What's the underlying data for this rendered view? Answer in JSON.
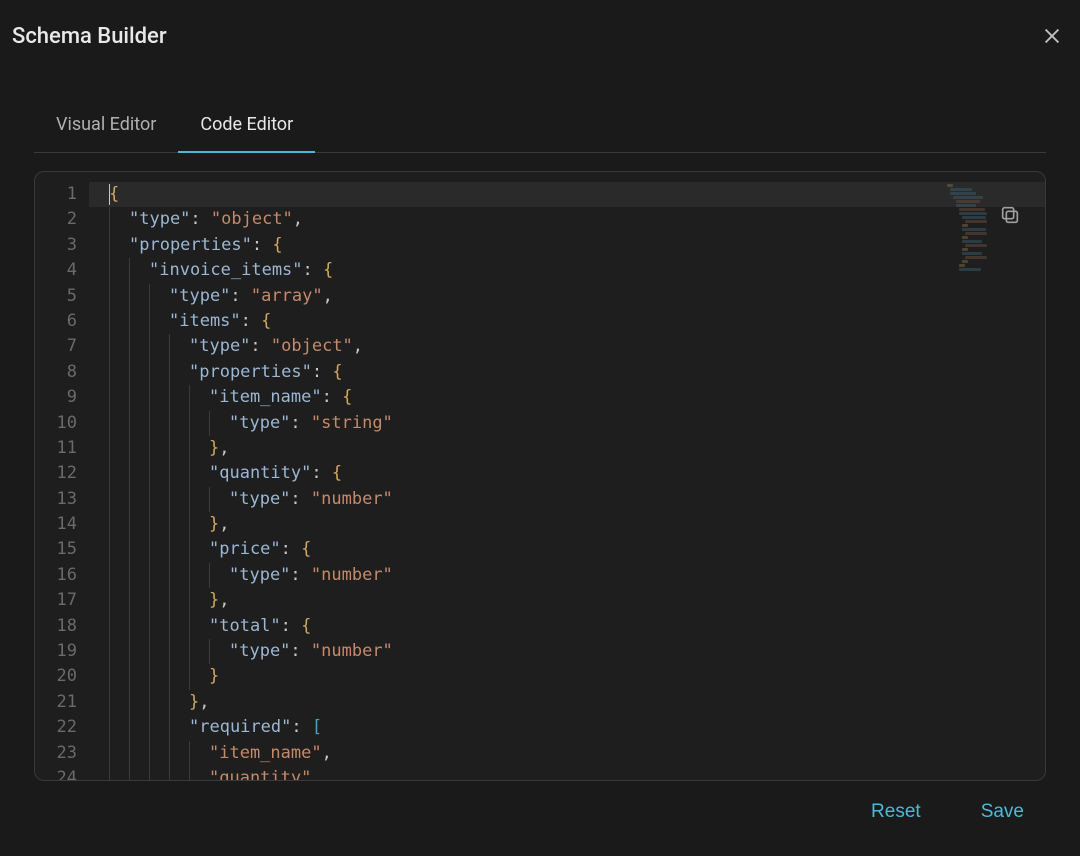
{
  "dialog": {
    "title": "Schema Builder"
  },
  "tabs": {
    "visual": "Visual Editor",
    "code": "Code Editor",
    "active": "code"
  },
  "editor": {
    "line_count": 24,
    "cursor_line": 1,
    "visible_lines": [
      1,
      2,
      3,
      4,
      5,
      6,
      7,
      8,
      9,
      10,
      11,
      12,
      13,
      14,
      15,
      16,
      17,
      18,
      19,
      20,
      21,
      22,
      23,
      24
    ],
    "code_lines": [
      [
        {
          "t": "brace",
          "v": "{"
        }
      ],
      [
        {
          "t": "pad",
          "w": 1
        },
        {
          "t": "key",
          "v": "\"type\""
        },
        {
          "t": "punc",
          "v": ": "
        },
        {
          "t": "string",
          "v": "\"object\""
        },
        {
          "t": "comma",
          "v": ","
        }
      ],
      [
        {
          "t": "pad",
          "w": 1
        },
        {
          "t": "key",
          "v": "\"properties\""
        },
        {
          "t": "punc",
          "v": ": "
        },
        {
          "t": "brace",
          "v": "{"
        }
      ],
      [
        {
          "t": "pad",
          "w": 2
        },
        {
          "t": "key",
          "v": "\"invoice_items\""
        },
        {
          "t": "punc",
          "v": ": "
        },
        {
          "t": "brace",
          "v": "{"
        }
      ],
      [
        {
          "t": "pad",
          "w": 3
        },
        {
          "t": "key",
          "v": "\"type\""
        },
        {
          "t": "punc",
          "v": ": "
        },
        {
          "t": "string",
          "v": "\"array\""
        },
        {
          "t": "comma",
          "v": ","
        }
      ],
      [
        {
          "t": "pad",
          "w": 3
        },
        {
          "t": "key",
          "v": "\"items\""
        },
        {
          "t": "punc",
          "v": ": "
        },
        {
          "t": "brace",
          "v": "{"
        }
      ],
      [
        {
          "t": "pad",
          "w": 4
        },
        {
          "t": "key",
          "v": "\"type\""
        },
        {
          "t": "punc",
          "v": ": "
        },
        {
          "t": "string",
          "v": "\"object\""
        },
        {
          "t": "comma",
          "v": ","
        }
      ],
      [
        {
          "t": "pad",
          "w": 4
        },
        {
          "t": "key",
          "v": "\"properties\""
        },
        {
          "t": "punc",
          "v": ": "
        },
        {
          "t": "brace",
          "v": "{"
        }
      ],
      [
        {
          "t": "pad",
          "w": 5
        },
        {
          "t": "key",
          "v": "\"item_name\""
        },
        {
          "t": "punc",
          "v": ": "
        },
        {
          "t": "brace",
          "v": "{"
        }
      ],
      [
        {
          "t": "pad",
          "w": 6
        },
        {
          "t": "key",
          "v": "\"type\""
        },
        {
          "t": "punc",
          "v": ": "
        },
        {
          "t": "string",
          "v": "\"string\""
        }
      ],
      [
        {
          "t": "pad",
          "w": 5
        },
        {
          "t": "brace",
          "v": "}"
        },
        {
          "t": "comma",
          "v": ","
        }
      ],
      [
        {
          "t": "pad",
          "w": 5
        },
        {
          "t": "key",
          "v": "\"quantity\""
        },
        {
          "t": "punc",
          "v": ": "
        },
        {
          "t": "brace",
          "v": "{"
        }
      ],
      [
        {
          "t": "pad",
          "w": 6
        },
        {
          "t": "key",
          "v": "\"type\""
        },
        {
          "t": "punc",
          "v": ": "
        },
        {
          "t": "string",
          "v": "\"number\""
        }
      ],
      [
        {
          "t": "pad",
          "w": 5
        },
        {
          "t": "brace",
          "v": "}"
        },
        {
          "t": "comma",
          "v": ","
        }
      ],
      [
        {
          "t": "pad",
          "w": 5
        },
        {
          "t": "key",
          "v": "\"price\""
        },
        {
          "t": "punc",
          "v": ": "
        },
        {
          "t": "brace",
          "v": "{"
        }
      ],
      [
        {
          "t": "pad",
          "w": 6
        },
        {
          "t": "key",
          "v": "\"type\""
        },
        {
          "t": "punc",
          "v": ": "
        },
        {
          "t": "string",
          "v": "\"number\""
        }
      ],
      [
        {
          "t": "pad",
          "w": 5
        },
        {
          "t": "brace",
          "v": "}"
        },
        {
          "t": "comma",
          "v": ","
        }
      ],
      [
        {
          "t": "pad",
          "w": 5
        },
        {
          "t": "key",
          "v": "\"total\""
        },
        {
          "t": "punc",
          "v": ": "
        },
        {
          "t": "brace",
          "v": "{"
        }
      ],
      [
        {
          "t": "pad",
          "w": 6
        },
        {
          "t": "key",
          "v": "\"type\""
        },
        {
          "t": "punc",
          "v": ": "
        },
        {
          "t": "string",
          "v": "\"number\""
        }
      ],
      [
        {
          "t": "pad",
          "w": 5
        },
        {
          "t": "brace",
          "v": "}"
        }
      ],
      [
        {
          "t": "pad",
          "w": 4
        },
        {
          "t": "brace",
          "v": "}"
        },
        {
          "t": "comma",
          "v": ","
        }
      ],
      [
        {
          "t": "pad",
          "w": 4
        },
        {
          "t": "key",
          "v": "\"required\""
        },
        {
          "t": "punc",
          "v": ": "
        },
        {
          "t": "bracket",
          "v": "["
        }
      ],
      [
        {
          "t": "pad",
          "w": 5
        },
        {
          "t": "string",
          "v": "\"item_name\""
        },
        {
          "t": "comma",
          "v": ","
        }
      ],
      [
        {
          "t": "pad",
          "w": 5
        },
        {
          "t": "string",
          "v": "\"quantity\""
        },
        {
          "t": "comma",
          "v": ","
        }
      ]
    ]
  },
  "footer": {
    "reset": "Reset",
    "save": "Save"
  }
}
